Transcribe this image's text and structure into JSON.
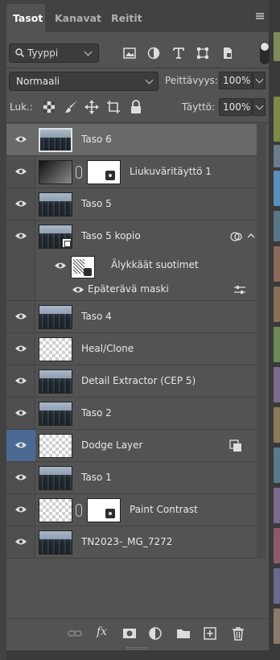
{
  "tabs": [
    {
      "label": "Tasot",
      "active": true
    },
    {
      "label": "Kanavat",
      "active": false
    },
    {
      "label": "Reitit",
      "active": false
    }
  ],
  "filter": {
    "kind_label": "Tyyppi",
    "icons": [
      "image-filter-icon",
      "adjustment-filter-icon",
      "type-filter-icon",
      "shape-filter-icon",
      "smart-object-filter-icon"
    ]
  },
  "blend": {
    "mode": "Normaali",
    "opacity_label": "Peittävyys:",
    "opacity_value": "100%",
    "lock_label": "Luk.:",
    "fill_label": "Täyttö:",
    "fill_value": "100%",
    "lock_icons": [
      "lock-transparency-icon",
      "lock-pixels-icon",
      "lock-position-icon",
      "lock-artboard-icon",
      "lock-all-icon"
    ]
  },
  "layers": [
    {
      "name": "Taso 6",
      "thumb": "photo",
      "selected": true
    },
    {
      "name": "Liukuväritäyttö 1",
      "thumb": "gradient",
      "mask": true
    },
    {
      "name": "Taso 5",
      "thumb": "photo"
    },
    {
      "name": "Taso 5 kopio",
      "thumb": "photo",
      "smart": true
    },
    {
      "name": "Taso 4",
      "thumb": "photo"
    },
    {
      "name": "Heal/Clone",
      "thumb": "checker"
    },
    {
      "name": "Detail Extractor (CEP 5)",
      "thumb": "photo"
    },
    {
      "name": "Taso 2",
      "thumb": "photo"
    },
    {
      "name": "Dodge Layer",
      "thumb": "checker",
      "eye_highlight": true
    },
    {
      "name": "Taso 1",
      "thumb": "photo"
    },
    {
      "name": "Paint Contrast",
      "thumb": "checker",
      "mask": true
    },
    {
      "name": "TN2023-_MG_7272",
      "thumb": "photo"
    }
  ],
  "smart_filters": {
    "group_label": "Älykkäät suotimet",
    "filter_name": "Epäterävä maski"
  },
  "bottom_icons": [
    "link-layers-icon",
    "fx-icon",
    "add-mask-icon",
    "adjustment-layer-icon",
    "group-folder-icon",
    "new-layer-icon",
    "trash-icon"
  ],
  "fx_label": "fx"
}
